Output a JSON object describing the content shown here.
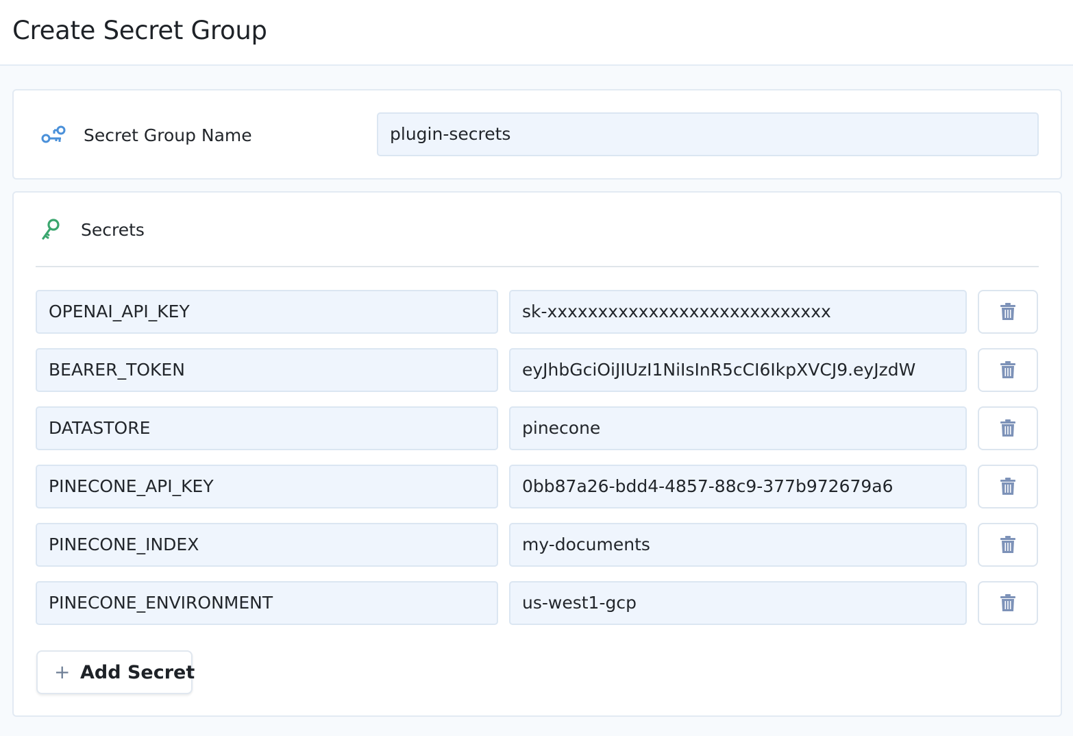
{
  "page": {
    "title": "Create Secret Group"
  },
  "group_name": {
    "label": "Secret Group Name",
    "value": "plugin-secrets",
    "icon": "keys-icon"
  },
  "secrets": {
    "label": "Secrets",
    "icon": "key-icon",
    "items": [
      {
        "key": "OPENAI_API_KEY",
        "value": "sk-xxxxxxxxxxxxxxxxxxxxxxxxxxxx"
      },
      {
        "key": "BEARER_TOKEN",
        "value": "eyJhbGciOiJIUzI1NiIsInR5cCI6IkpXVCJ9.eyJzdW"
      },
      {
        "key": "DATASTORE",
        "value": "pinecone"
      },
      {
        "key": "PINECONE_API_KEY",
        "value": "0bb87a26-bdd4-4857-88c9-377b972679a6"
      },
      {
        "key": "PINECONE_INDEX",
        "value": "my-documents"
      },
      {
        "key": "PINECONE_ENVIRONMENT",
        "value": "us-west1-gcp"
      }
    ],
    "delete_icon": "trash-icon",
    "add_button_label": "Add Secret",
    "add_icon": "plus-icon"
  },
  "colors": {
    "accent_blue": "#4a90d9",
    "key_green": "#3aa66e",
    "field_bg": "#eff5fd",
    "trash": "#7d92b8"
  }
}
